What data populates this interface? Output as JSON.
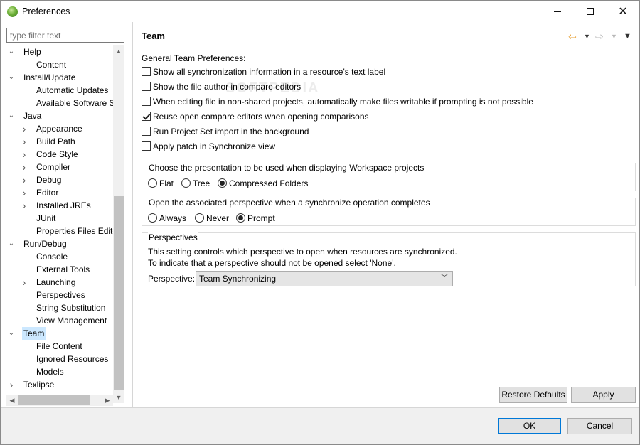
{
  "window": {
    "title": "Preferences"
  },
  "filter": {
    "placeholder": "type filter text"
  },
  "tree": [
    {
      "label": "Help",
      "level": 0,
      "expander": "open"
    },
    {
      "label": "Content",
      "level": 1,
      "expander": "none"
    },
    {
      "label": "Install/Update",
      "level": 0,
      "expander": "open"
    },
    {
      "label": "Automatic Updates",
      "level": 1,
      "expander": "none"
    },
    {
      "label": "Available Software S",
      "level": 1,
      "expander": "none"
    },
    {
      "label": "Java",
      "level": 0,
      "expander": "open"
    },
    {
      "label": "Appearance",
      "level": 1,
      "expander": "closed"
    },
    {
      "label": "Build Path",
      "level": 1,
      "expander": "closed"
    },
    {
      "label": "Code Style",
      "level": 1,
      "expander": "closed"
    },
    {
      "label": "Compiler",
      "level": 1,
      "expander": "closed"
    },
    {
      "label": "Debug",
      "level": 1,
      "expander": "closed"
    },
    {
      "label": "Editor",
      "level": 1,
      "expander": "closed"
    },
    {
      "label": "Installed JREs",
      "level": 1,
      "expander": "closed"
    },
    {
      "label": "JUnit",
      "level": 1,
      "expander": "none"
    },
    {
      "label": "Properties Files Edito",
      "level": 1,
      "expander": "none"
    },
    {
      "label": "Run/Debug",
      "level": 0,
      "expander": "open"
    },
    {
      "label": "Console",
      "level": 1,
      "expander": "none"
    },
    {
      "label": "External Tools",
      "level": 1,
      "expander": "none"
    },
    {
      "label": "Launching",
      "level": 1,
      "expander": "closed"
    },
    {
      "label": "Perspectives",
      "level": 1,
      "expander": "none"
    },
    {
      "label": "String Substitution",
      "level": 1,
      "expander": "none"
    },
    {
      "label": "View Management",
      "level": 1,
      "expander": "none"
    },
    {
      "label": "Team",
      "level": 0,
      "expander": "open",
      "selected": true
    },
    {
      "label": "File Content",
      "level": 1,
      "expander": "none"
    },
    {
      "label": "Ignored Resources",
      "level": 1,
      "expander": "none"
    },
    {
      "label": "Models",
      "level": 1,
      "expander": "none"
    },
    {
      "label": "Texlipse",
      "level": 0,
      "expander": "closed"
    }
  ],
  "page": {
    "title": "Team",
    "section_label": "General Team Preferences:",
    "checkboxes": [
      {
        "label": "Show all synchronization information in a resource's text label",
        "checked": false
      },
      {
        "label": "Show the file author in compare editors",
        "checked": false
      },
      {
        "label": "When editing file in non-shared projects, automatically make files writable if prompting is not possible",
        "checked": false
      },
      {
        "label": "Reuse open compare editors when opening comparisons",
        "checked": true
      },
      {
        "label": "Run Project Set import in the background",
        "checked": false
      },
      {
        "label": "Apply patch in Synchronize view",
        "checked": false
      }
    ],
    "presentation_group": {
      "title": "Choose the presentation to be used when displaying Workspace projects",
      "options": [
        "Flat",
        "Tree",
        "Compressed Folders"
      ],
      "selected": "Compressed Folders"
    },
    "perspective_group": {
      "title": "Open the associated perspective when a synchronize operation completes",
      "options": [
        "Always",
        "Never",
        "Prompt"
      ],
      "selected": "Prompt"
    },
    "perspectives_group": {
      "title": "Perspectives",
      "line1": "This setting controls which perspective to open when resources are synchronized.",
      "line2": "To indicate that a perspective should not be opened select 'None'.",
      "select_label": "Perspective:",
      "select_value": "Team Synchronizing"
    },
    "restore_defaults": "Restore Defaults",
    "apply": "Apply"
  },
  "footer": {
    "ok": "OK",
    "cancel": "Cancel"
  },
  "colors": {
    "selection": "#cce8ff",
    "default_button_border": "#0078d7",
    "back_arrow": "#e8a33a"
  },
  "icons": {
    "back": "back-arrow-icon",
    "forward": "forward-arrow-icon",
    "menu": "view-menu-icon"
  }
}
